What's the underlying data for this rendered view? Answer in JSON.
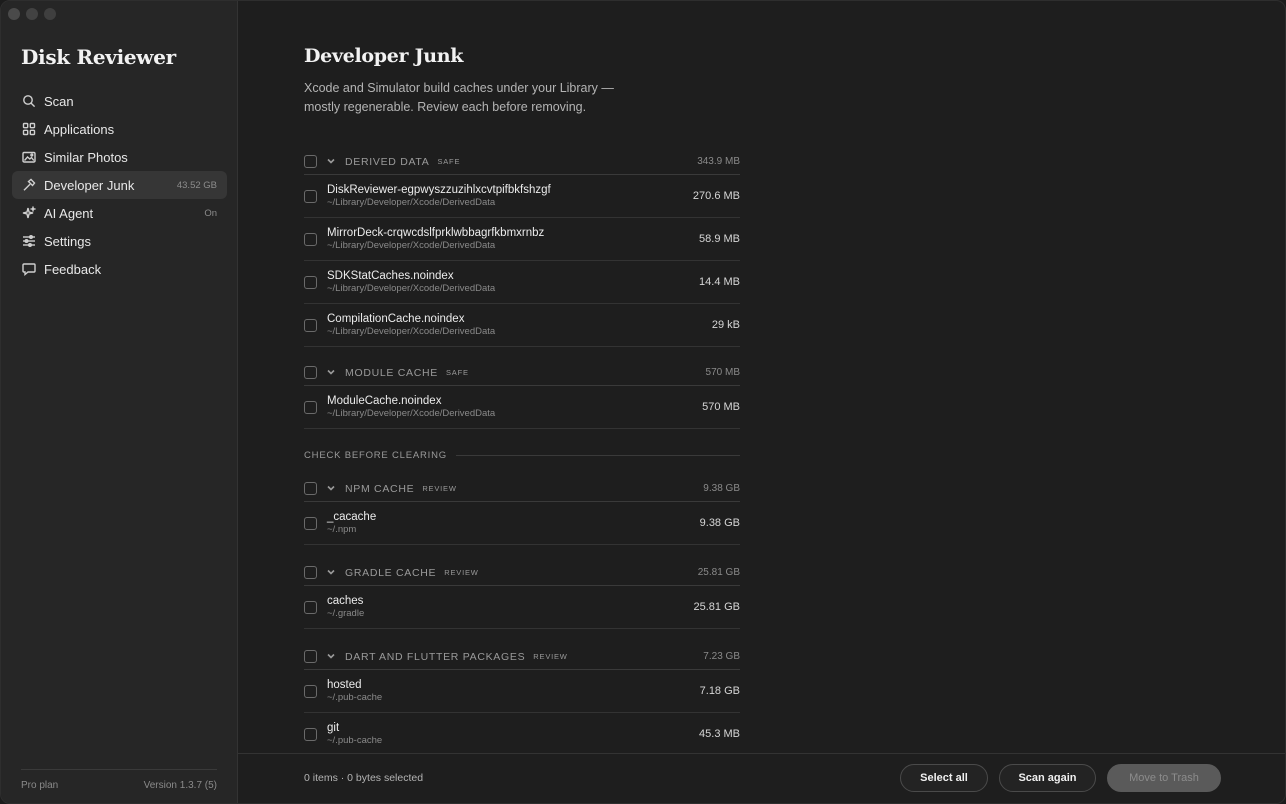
{
  "app": {
    "title": "Disk Reviewer"
  },
  "sidebar": {
    "items": [
      {
        "label": "Scan",
        "icon": "search-icon",
        "badge": ""
      },
      {
        "label": "Applications",
        "icon": "grid-icon",
        "badge": ""
      },
      {
        "label": "Similar Photos",
        "icon": "photos-icon",
        "badge": ""
      },
      {
        "label": "Developer Junk",
        "icon": "hammer-icon",
        "badge": "43.52 GB"
      },
      {
        "label": "AI Agent",
        "icon": "sparkle-icon",
        "badge": "On"
      },
      {
        "label": "Settings",
        "icon": "sliders-icon",
        "badge": ""
      },
      {
        "label": "Feedback",
        "icon": "chat-bubble-icon",
        "badge": ""
      }
    ],
    "active_index": 3,
    "footer": {
      "plan": "Pro plan",
      "version": "Version 1.3.7 (5)"
    }
  },
  "main": {
    "title": "Developer Junk",
    "description": "Xcode and Simulator build caches under your Library — mostly regenerable. Review each before removing.",
    "groups": [
      {
        "name": "DERIVED DATA",
        "tag": "SAFE",
        "size": "343.9 MB",
        "items": [
          {
            "name": "DiskReviewer-egpwyszzuzihlxcvtpifbkfshzgf",
            "path": "~/Library/Developer/Xcode/DerivedData",
            "size": "270.6 MB"
          },
          {
            "name": "MirrorDeck-crqwcdslfprklwbbagrfkbmxrnbz",
            "path": "~/Library/Developer/Xcode/DerivedData",
            "size": "58.9 MB"
          },
          {
            "name": "SDKStatCaches.noindex",
            "path": "~/Library/Developer/Xcode/DerivedData",
            "size": "14.4 MB"
          },
          {
            "name": "CompilationCache.noindex",
            "path": "~/Library/Developer/Xcode/DerivedData",
            "size": "29 kB"
          }
        ]
      },
      {
        "name": "MODULE CACHE",
        "tag": "SAFE",
        "size": "570 MB",
        "items": [
          {
            "name": "ModuleCache.noindex",
            "path": "~/Library/Developer/Xcode/DerivedData",
            "size": "570 MB"
          }
        ]
      }
    ],
    "section_label": "CHECK BEFORE CLEARING",
    "review_groups": [
      {
        "name": "NPM CACHE",
        "tag": "REVIEW",
        "size": "9.38 GB",
        "items": [
          {
            "name": "_cacache",
            "path": "~/.npm",
            "size": "9.38 GB"
          }
        ]
      },
      {
        "name": "GRADLE CACHE",
        "tag": "REVIEW",
        "size": "25.81 GB",
        "items": [
          {
            "name": "caches",
            "path": "~/.gradle",
            "size": "25.81 GB"
          }
        ]
      },
      {
        "name": "DART AND FLUTTER PACKAGES",
        "tag": "REVIEW",
        "size": "7.23 GB",
        "items": [
          {
            "name": "hosted",
            "path": "~/.pub-cache",
            "size": "7.18 GB"
          },
          {
            "name": "git",
            "path": "~/.pub-cache",
            "size": "45.3 MB"
          }
        ]
      }
    ]
  },
  "bottombar": {
    "status": "0 items · 0 bytes selected",
    "select_all": "Select all",
    "scan_again": "Scan again",
    "move_to_trash": "Move to Trash"
  }
}
